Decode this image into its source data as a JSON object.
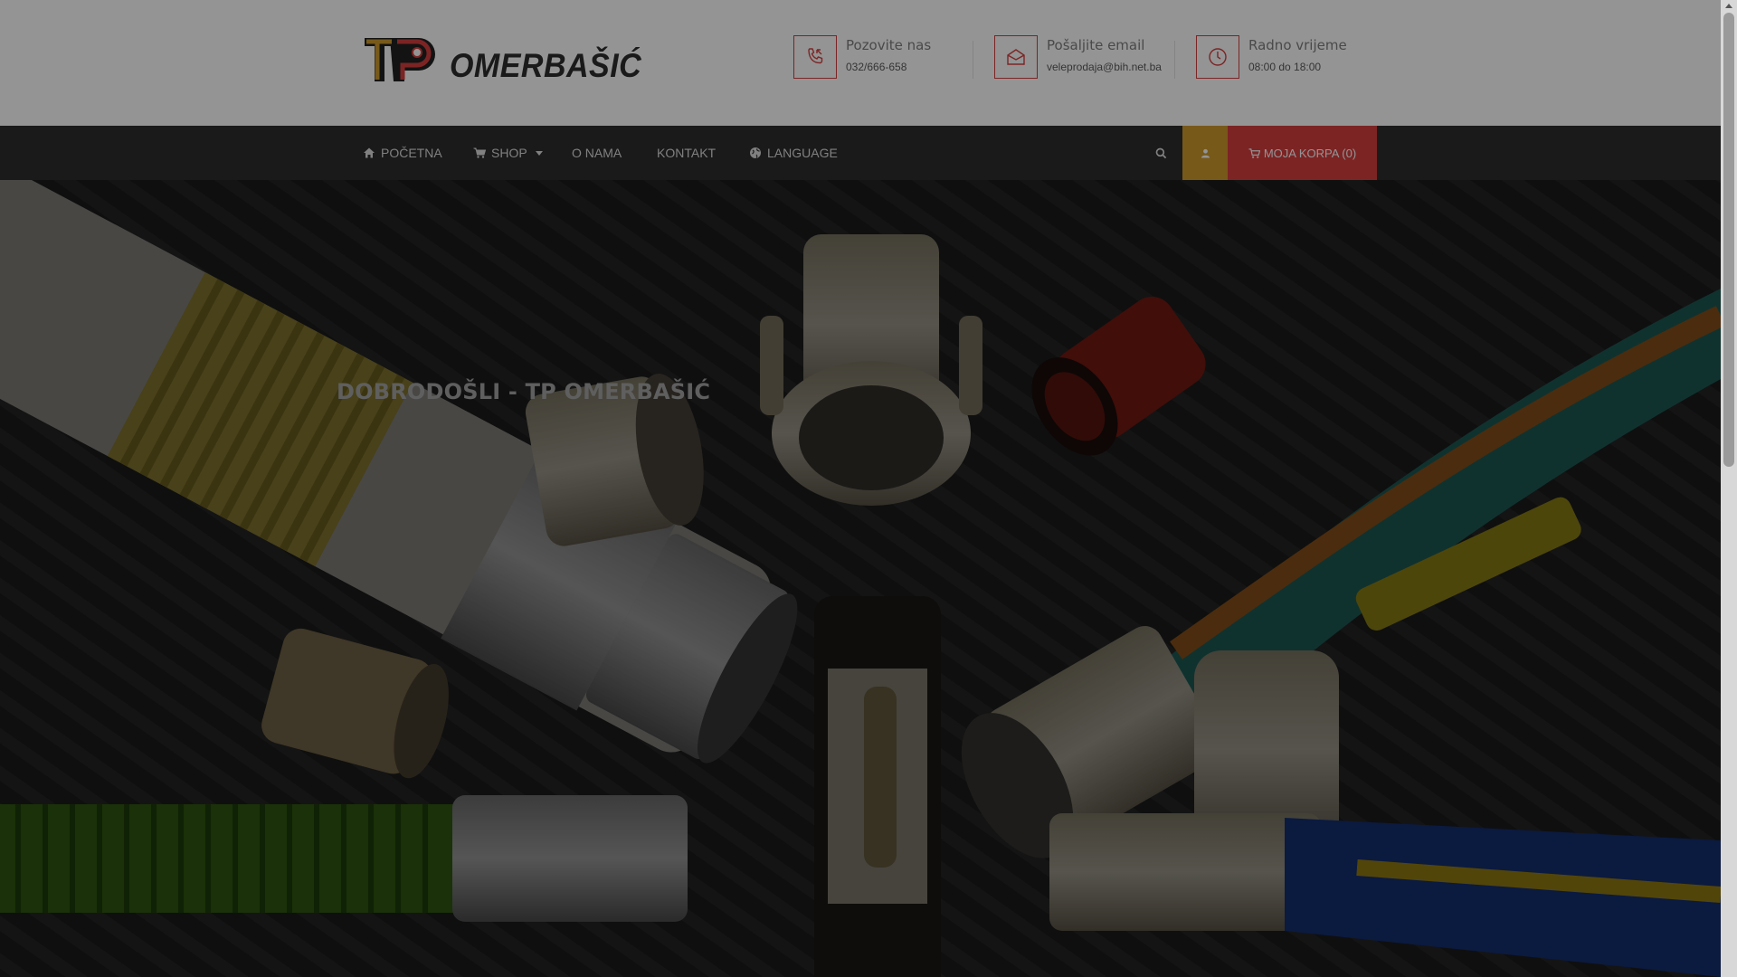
{
  "header": {
    "logo_text": "OMERBAŠIĆ",
    "logo_mark": "TP",
    "contacts": [
      {
        "icon": "phone-icon",
        "title": "Pozovite nas",
        "value": "032/666-658"
      },
      {
        "icon": "envelope-icon",
        "title": "Pošaljite email",
        "value": "veleprodaja@bih.net.ba"
      },
      {
        "icon": "clock-icon",
        "title": "Radno vrijeme",
        "value": "08:00 do 18:00"
      }
    ]
  },
  "nav": {
    "items": [
      {
        "icon": "home-icon",
        "label": "POČETNA"
      },
      {
        "icon": "cart-icon",
        "label": "SHOP"
      },
      {
        "label": "O NAMA"
      },
      {
        "label": "KONTAKT"
      },
      {
        "icon": "globe-icon",
        "label": "LANGUAGE"
      }
    ],
    "cart_label": "MOJA KORPA (0)"
  },
  "hero": {
    "title": "DOBRODOŠLI - TP OMERBAŠIĆ"
  },
  "colors": {
    "accent_red": "#c93b3b",
    "accent_gold": "#c0902a",
    "navbar": "#2a2a2a",
    "header_bg": "#efefef"
  }
}
